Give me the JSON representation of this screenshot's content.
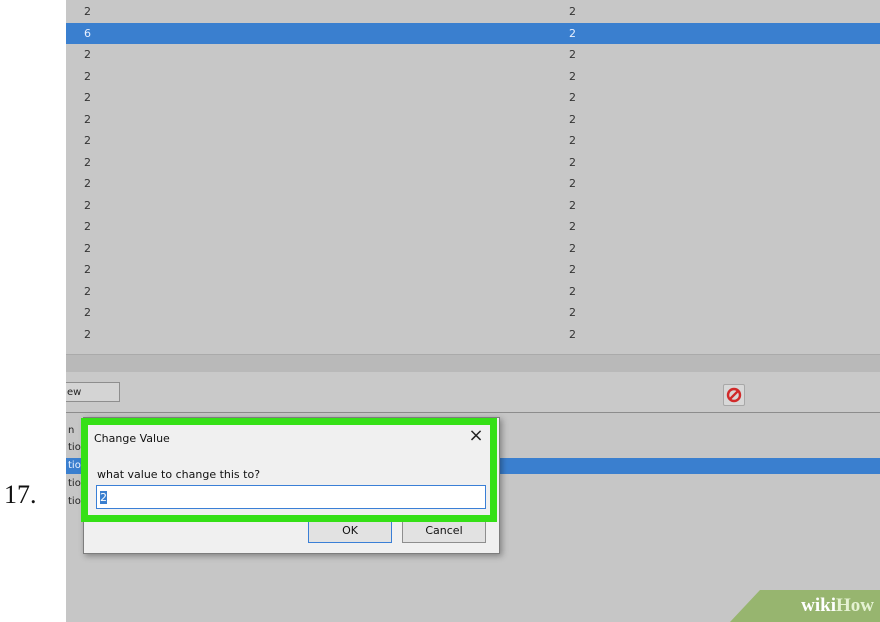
{
  "step_number": "17.",
  "top_list": {
    "rows": [
      {
        "col1": "2",
        "col2": "2",
        "selected": false
      },
      {
        "col1": "6",
        "col2": "2",
        "selected": true
      },
      {
        "col1": "2",
        "col2": "2",
        "selected": false
      },
      {
        "col1": "2",
        "col2": "2",
        "selected": false
      },
      {
        "col1": "2",
        "col2": "2",
        "selected": false
      },
      {
        "col1": "2",
        "col2": "2",
        "selected": false
      },
      {
        "col1": "2",
        "col2": "2",
        "selected": false
      },
      {
        "col1": "2",
        "col2": "2",
        "selected": false
      },
      {
        "col1": "2",
        "col2": "2",
        "selected": false
      },
      {
        "col1": "2",
        "col2": "2",
        "selected": false
      },
      {
        "col1": "2",
        "col2": "2",
        "selected": false
      },
      {
        "col1": "2",
        "col2": "2",
        "selected": false
      },
      {
        "col1": "2",
        "col2": "2",
        "selected": false
      },
      {
        "col1": "2",
        "col2": "2",
        "selected": false
      },
      {
        "col1": "2",
        "col2": "2",
        "selected": false
      },
      {
        "col1": "2",
        "col2": "2",
        "selected": false
      }
    ]
  },
  "toolbar": {
    "new_button_label": "ew",
    "stop_icon": "no-entry-icon"
  },
  "bottom_list": {
    "rows": [
      {
        "text": "n",
        "selected": false
      },
      {
        "text": "tio",
        "selected": false
      },
      {
        "text": "tio",
        "selected": true
      },
      {
        "text": "tio",
        "selected": false
      },
      {
        "text": "tio",
        "selected": false
      }
    ]
  },
  "dialog": {
    "title": "Change Value",
    "prompt": "what value to change this to?",
    "value": "2",
    "ok_label": "OK",
    "cancel_label": "Cancel",
    "close_icon": "close-icon"
  },
  "watermark": {
    "part1": "wiki",
    "part2": "How"
  },
  "colors": {
    "selection": "#3a7fcf",
    "highlight": "#35e016",
    "watermark_bg": "#97b56f"
  }
}
